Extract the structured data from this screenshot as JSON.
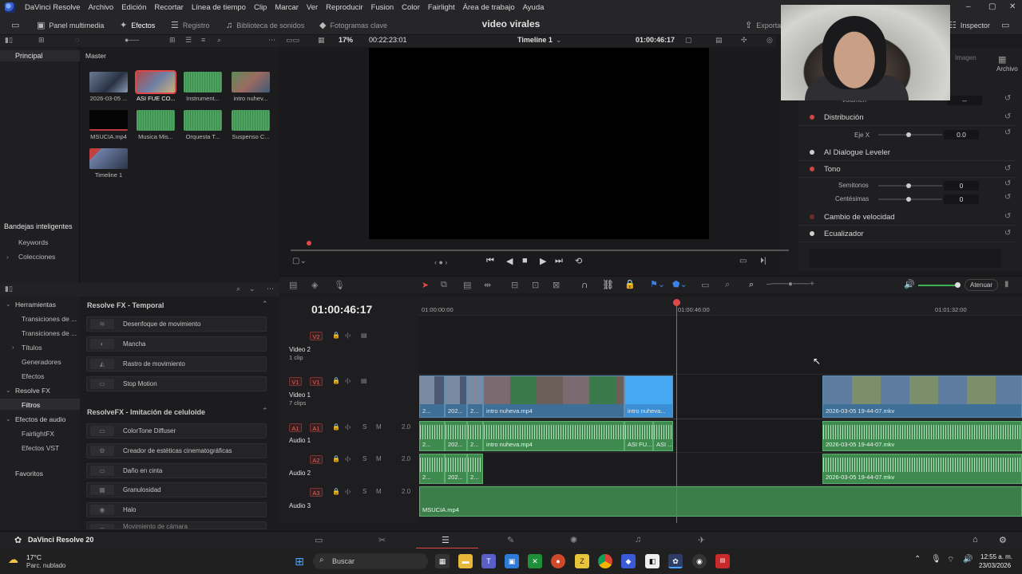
{
  "app": {
    "menu": [
      "DaVinci Resolve",
      "Archivo",
      "Edición",
      "Recortar",
      "Línea de tiempo",
      "Clip",
      "Marcar",
      "Ver",
      "Reproducir",
      "Fusion",
      "Color",
      "Fairlight",
      "Área de trabajo",
      "Ayuda"
    ],
    "project_title": "video virales"
  },
  "toolbar": {
    "media_pool": "Panel multimedia",
    "effects": "Efectos",
    "log": "Registro",
    "sound_library": "Biblioteca de sonidos",
    "keyframes": "Fotogramas clave",
    "export": "Exporta",
    "inspector": "Inspector"
  },
  "viewer": {
    "zoom": "17%",
    "duration": "00:22:23:01",
    "timeline_name": "Timeline 1",
    "timecode": "01:00:46:17"
  },
  "bins": {
    "main": "Principal",
    "master": "Master",
    "smart_bins_title": "Bandejas inteligentes",
    "smart_items": [
      "Keywords",
      "Colecciones"
    ]
  },
  "media_pool": {
    "clips": [
      "2026-03-05 ...",
      "ASI FUE CO...",
      "Instrument...",
      "intro nuhev...",
      "MSUCIA.mp4",
      "Musica Mis...",
      "Orquesta T...",
      "Suspenso C...",
      "Timeline 1"
    ]
  },
  "inspector": {
    "tabs": [
      "Imagen",
      "Archivo"
    ],
    "volume_label": "Volumen",
    "volume_value": "--",
    "rows": [
      {
        "label": "Distribución"
      },
      {
        "label": "AI Dialogue Leveler"
      },
      {
        "label": "Tono"
      },
      {
        "label": "Cambio de velocidad"
      },
      {
        "label": "Ecualizador"
      }
    ],
    "eje_x_label": "Eje X",
    "eje_x_value": "0.0",
    "semitones_label": "Semitonos",
    "semitones_value": "0",
    "cents_label": "Centésimas",
    "cents_value": "0"
  },
  "effects_tree": {
    "items": [
      {
        "label": "Herramientas",
        "level": 0,
        "open": true
      },
      {
        "label": "Transiciones de ...",
        "level": 1
      },
      {
        "label": "Transiciones de ...",
        "level": 1
      },
      {
        "label": "Títulos",
        "level": 1,
        "collapsed": true
      },
      {
        "label": "Generadores",
        "level": 1
      },
      {
        "label": "Efectos",
        "level": 1
      },
      {
        "label": "Resolve FX",
        "level": 0,
        "open": true
      },
      {
        "label": "Filtros",
        "level": 1,
        "selected": true
      },
      {
        "label": "Efectos de audio",
        "level": 0,
        "open": true
      },
      {
        "label": "FairlightFX",
        "level": 1
      },
      {
        "label": "Efectos VST",
        "level": 1
      }
    ],
    "favorites": "Favoritos"
  },
  "effects_list": {
    "cat1": "Resolve FX - Temporal",
    "cat1_items": [
      "Desenfoque de movimiento",
      "Mancha",
      "Rastro de movimiento",
      "Stop Motion"
    ],
    "cat2": "ResolveFX - Imitación de celuloide",
    "cat2_items": [
      "ColorTone Diffuser",
      "Creador de estéticas cinematográficas",
      "Daño en cinta",
      "Granulosidad",
      "Halo",
      "Movimiento de cámara"
    ]
  },
  "timeline": {
    "timecode": "01:00:46:17",
    "ruler": [
      "01:00:00:00",
      "01:00:46:00",
      "01:01:32:00"
    ],
    "mute_label": "Atenuar",
    "tracks": [
      {
        "tag": "V2",
        "name": "Video 2",
        "sub": "1 clip"
      },
      {
        "tag": "V1",
        "name": "Video 1",
        "sub": "7 clips"
      },
      {
        "tag": "A1",
        "name": "Audio 1",
        "level": "2.0"
      },
      {
        "tag": "A2",
        "name": "Audio 2",
        "level": "2.0"
      },
      {
        "tag": "A3",
        "name": "Audio 3",
        "level": "2.0"
      }
    ],
    "v1_clips": [
      "2...",
      "202...",
      "2...",
      "intro nuheva.mp4",
      "intro nuheva...",
      "2026-03-05 19-44-07.mkv"
    ],
    "a1_clips": [
      "2...",
      "202...",
      "2...",
      "intro nuheva.mp4",
      "ASI FU...",
      "ASI ...",
      "2026-03-05 19-44-07.mkv"
    ],
    "a2_clips": [
      "2...",
      "202...",
      "2...",
      "2026-03-05 19-44-07.mkv"
    ],
    "a3_clip": "MSUCIA.mp4"
  },
  "footer": {
    "app_name": "DaVinci Resolve 20"
  },
  "taskbar": {
    "weather_temp": "17°C",
    "weather_desc": "Parc. nublado",
    "search": "Buscar",
    "time": "12:55 a. m.",
    "date": "23/03/2026"
  },
  "colors": {
    "accent_red": "#e04848",
    "video_clip": "#3d6f97",
    "audio_clip": "#3f8a4f"
  }
}
